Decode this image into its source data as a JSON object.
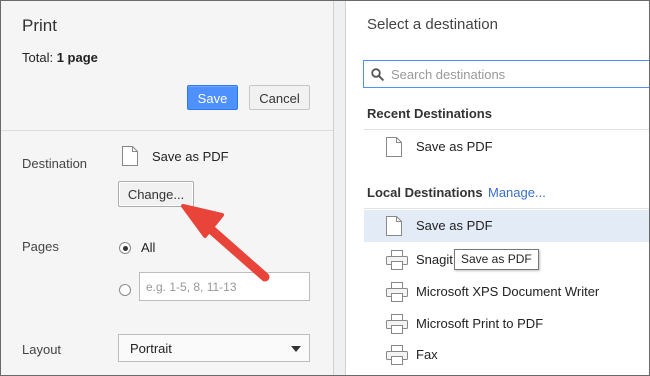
{
  "left": {
    "title": "Print",
    "total_label": "Total:",
    "total_value": "1 page",
    "save_label": "Save",
    "cancel_label": "Cancel",
    "destination_label": "Destination",
    "destination_value": "Save as PDF",
    "change_label": "Change...",
    "pages_label": "Pages",
    "pages_all_label": "All",
    "pages_custom_placeholder": "e.g. 1-5, 8, 11-13",
    "layout_label": "Layout",
    "layout_value": "Portrait"
  },
  "dialog": {
    "title": "Select a destination",
    "search_placeholder": "Search destinations",
    "recent_header": "Recent Destinations",
    "recent_items": [
      {
        "label": "Save as PDF",
        "icon": "document-icon"
      }
    ],
    "local_header": "Local Destinations",
    "manage_label": "Manage...",
    "local_items": [
      {
        "label": "Save as PDF",
        "icon": "document-icon",
        "selected": true
      },
      {
        "label": "Snagit",
        "icon": "printer-icon"
      },
      {
        "label": "Microsoft XPS Document Writer",
        "icon": "printer-icon"
      },
      {
        "label": "Microsoft Print to PDF",
        "icon": "printer-icon"
      },
      {
        "label": "Fax",
        "icon": "printer-icon"
      }
    ],
    "tooltip": "Save as PDF"
  },
  "colors": {
    "accent": "#4d90fe",
    "link": "#3a6fc9",
    "annotation_arrow": "#e8443a",
    "selected_row": "#e3ebf7"
  }
}
